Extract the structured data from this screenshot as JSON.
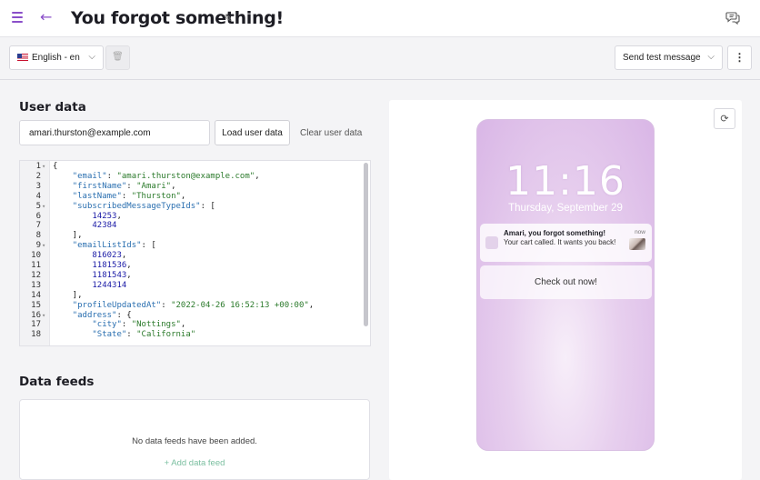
{
  "header": {
    "title": "You forgot something!",
    "menu_icon": "hamburger-icon",
    "back_icon": "arrow-left-icon",
    "edit_icon": "pencil-icon",
    "comment_icon": "chat-bubble-icon"
  },
  "toolbar": {
    "language": "English - en",
    "send_test_label": "Send test message"
  },
  "user_data": {
    "heading": "User data",
    "email_value": "amari.thurston@example.com",
    "load_label": "Load user data",
    "clear_label": "Clear user data",
    "code_lines": [
      {
        "n": "1",
        "fold": true,
        "parts": [
          [
            "p",
            "{"
          ]
        ]
      },
      {
        "n": "2",
        "fold": false,
        "parts": [
          [
            "p",
            "    "
          ],
          [
            "k",
            "\"email\""
          ],
          [
            "p",
            ": "
          ],
          [
            "s",
            "\"amari.thurston@example.com\""
          ],
          [
            "p",
            ","
          ]
        ]
      },
      {
        "n": "3",
        "fold": false,
        "parts": [
          [
            "p",
            "    "
          ],
          [
            "k",
            "\"firstName\""
          ],
          [
            "p",
            ": "
          ],
          [
            "s",
            "\"Amari\""
          ],
          [
            "p",
            ","
          ]
        ]
      },
      {
        "n": "4",
        "fold": false,
        "parts": [
          [
            "p",
            "    "
          ],
          [
            "k",
            "\"lastName\""
          ],
          [
            "p",
            ": "
          ],
          [
            "s",
            "\"Thurston\""
          ],
          [
            "p",
            ","
          ]
        ]
      },
      {
        "n": "5",
        "fold": true,
        "parts": [
          [
            "p",
            "    "
          ],
          [
            "k",
            "\"subscribedMessageTypeIds\""
          ],
          [
            "p",
            ": ["
          ]
        ]
      },
      {
        "n": "6",
        "fold": false,
        "parts": [
          [
            "p",
            "        "
          ],
          [
            "n",
            "14253"
          ],
          [
            "p",
            ","
          ]
        ]
      },
      {
        "n": "7",
        "fold": false,
        "parts": [
          [
            "p",
            "        "
          ],
          [
            "n",
            "42384"
          ]
        ]
      },
      {
        "n": "8",
        "fold": false,
        "parts": [
          [
            "p",
            "    ],"
          ]
        ]
      },
      {
        "n": "9",
        "fold": true,
        "parts": [
          [
            "p",
            "    "
          ],
          [
            "k",
            "\"emailListIds\""
          ],
          [
            "p",
            ": ["
          ]
        ]
      },
      {
        "n": "10",
        "fold": false,
        "parts": [
          [
            "p",
            "        "
          ],
          [
            "n",
            "816023"
          ],
          [
            "p",
            ","
          ]
        ]
      },
      {
        "n": "11",
        "fold": false,
        "parts": [
          [
            "p",
            "        "
          ],
          [
            "n",
            "1181536"
          ],
          [
            "p",
            ","
          ]
        ]
      },
      {
        "n": "12",
        "fold": false,
        "parts": [
          [
            "p",
            "        "
          ],
          [
            "n",
            "1181543"
          ],
          [
            "p",
            ","
          ]
        ]
      },
      {
        "n": "13",
        "fold": false,
        "parts": [
          [
            "p",
            "        "
          ],
          [
            "n",
            "1244314"
          ]
        ]
      },
      {
        "n": "14",
        "fold": false,
        "parts": [
          [
            "p",
            "    ],"
          ]
        ]
      },
      {
        "n": "15",
        "fold": false,
        "parts": [
          [
            "p",
            "    "
          ],
          [
            "k",
            "\"profileUpdatedAt\""
          ],
          [
            "p",
            ": "
          ],
          [
            "s",
            "\"2022-04-26 16:52:13 +00:00\""
          ],
          [
            "p",
            ","
          ]
        ]
      },
      {
        "n": "16",
        "fold": true,
        "parts": [
          [
            "p",
            "    "
          ],
          [
            "k",
            "\"address\""
          ],
          [
            "p",
            ": {"
          ]
        ]
      },
      {
        "n": "17",
        "fold": false,
        "parts": [
          [
            "p",
            "        "
          ],
          [
            "k",
            "\"city\""
          ],
          [
            "p",
            ": "
          ],
          [
            "s",
            "\"Nottings\""
          ],
          [
            "p",
            ","
          ]
        ]
      },
      {
        "n": "18",
        "fold": false,
        "parts": [
          [
            "p",
            "        "
          ],
          [
            "k",
            "\"State\""
          ],
          [
            "p",
            ": "
          ],
          [
            "s",
            "\"California\""
          ]
        ]
      }
    ]
  },
  "data_feeds": {
    "heading": "Data feeds",
    "empty_text": "No data feeds have been added.",
    "add_label": "+ Add data feed"
  },
  "preview": {
    "time": "11:16",
    "date": "Thursday, September 29",
    "notification": {
      "title": "Amari, you forgot something!",
      "body": "Your cart called. It wants you back!",
      "time": "now"
    },
    "action_label": "Check out now!"
  },
  "colors": {
    "accent": "#8a4fc9",
    "link_green": "#7bbfa0",
    "phone_bg": "#e7cfee"
  }
}
